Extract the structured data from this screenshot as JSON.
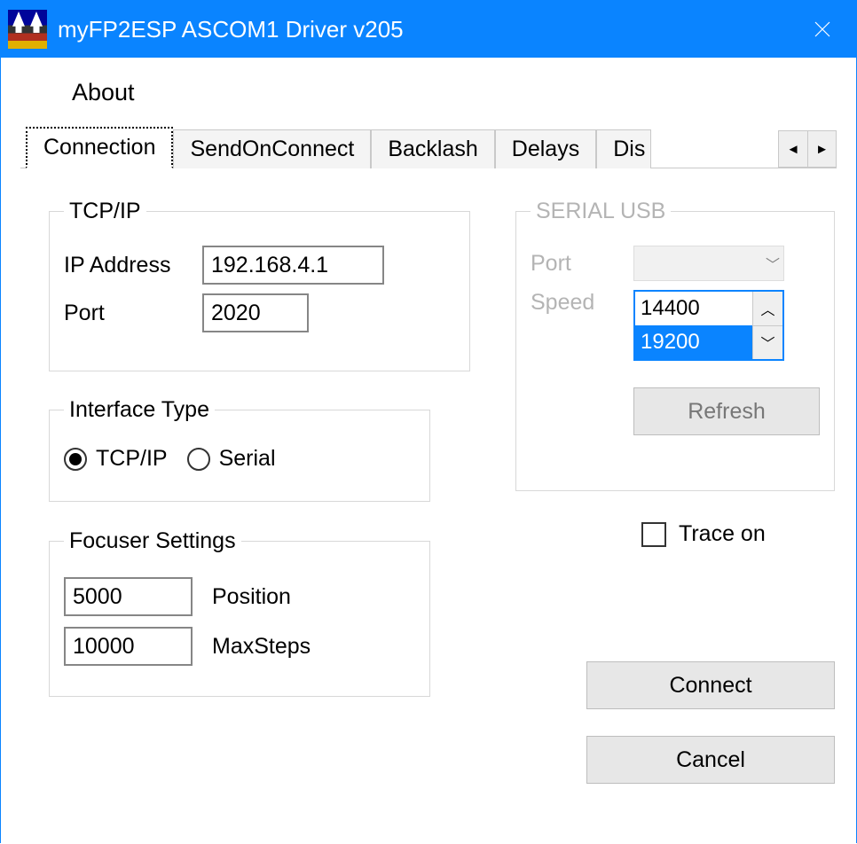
{
  "window": {
    "title": "myFP2ESP ASCOM1 Driver v205"
  },
  "menu": {
    "about": "About"
  },
  "tabs": {
    "connection": "Connection",
    "sendonconnect": "SendOnConnect",
    "backlash": "Backlash",
    "delays": "Delays",
    "display_partial": "Dis"
  },
  "tcpip": {
    "legend": "TCP/IP",
    "ip_label": "IP Address",
    "ip_value": "192.168.4.1",
    "port_label": "Port",
    "port_value": "2020"
  },
  "iface": {
    "legend": "Interface Type",
    "tcpip": "TCP/IP",
    "serial": "Serial"
  },
  "focuser": {
    "legend": "Focuser Settings",
    "position_label": "Position",
    "position_value": "5000",
    "maxsteps_label": "MaxSteps",
    "maxsteps_value": "10000"
  },
  "serial": {
    "legend": "SERIAL USB",
    "port_label": "Port",
    "speed_label": "Speed",
    "speed_visible_top": "14400",
    "speed_visible_sel": "19200",
    "refresh": "Refresh"
  },
  "trace": {
    "label": "Trace on"
  },
  "buttons": {
    "connect": "Connect",
    "cancel": "Cancel"
  }
}
